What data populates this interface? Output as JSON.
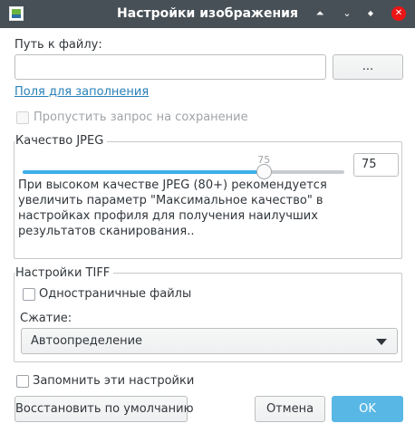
{
  "window": {
    "title": "Настройки изображения",
    "controls": {
      "keep_above": "⏶",
      "minimize": "⌄",
      "maximize": "◆",
      "close": "✕"
    }
  },
  "file_path": {
    "label": "Путь к файлу:",
    "value": "",
    "browse_label": "..."
  },
  "fill_fields_link": "Поля для заполнения",
  "skip_save_prompt": {
    "label": "Пропустить запрос на сохранение",
    "checked": false,
    "enabled": false
  },
  "jpeg": {
    "group_title": "Качество JPEG",
    "slider_min": 0,
    "slider_max": 100,
    "quality": 75,
    "quality_label": "75",
    "spin_value": "75",
    "hint": "При высоком качестве JPEG (80+) рекомендуется увеличить параметр \"Максимальное качество\" в настройках профиля для получения наилучших результатов сканирования.."
  },
  "tiff": {
    "group_title": "Настройки TIFF",
    "single_page": {
      "label": "Одностраничные файлы",
      "checked": false
    },
    "compression_label": "Сжатие:",
    "compression_value": "Автоопределение"
  },
  "remember": {
    "label": "Запомнить эти настройки",
    "checked": false
  },
  "buttons": {
    "restore": "Восстановить по умолчанию",
    "cancel": "Отмена",
    "ok": "OK"
  },
  "colors": {
    "titlebar": "#475057",
    "accent": "#3daee9",
    "ok_button": "#59b7e5",
    "close": "#ed1515",
    "link": "#2980b9"
  },
  "icons": {
    "dropdown": "chevron-down-icon",
    "app": "image-settings-icon"
  }
}
